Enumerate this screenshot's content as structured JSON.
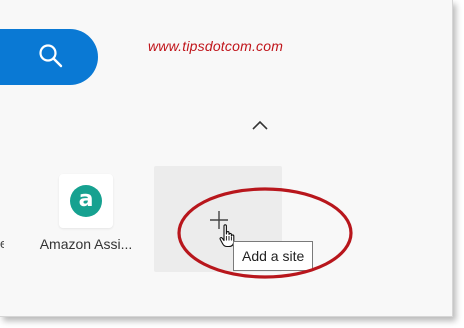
{
  "watermark": "www.tipsdotcom.com",
  "search": {
    "icon": "search-icon"
  },
  "chevron": {
    "icon": "chevron-up-icon"
  },
  "truncated_label": "e",
  "tiles": [
    {
      "label": "Amazon Assi...",
      "icon": "amazon-a-icon",
      "icon_letter": "a"
    }
  ],
  "add_site": {
    "icon": "plus-icon",
    "tooltip": "Add a site"
  },
  "colors": {
    "accent": "#0a79d4",
    "amazon": "#16a190",
    "watermark": "#c0141a",
    "highlight": "#c0141a"
  }
}
